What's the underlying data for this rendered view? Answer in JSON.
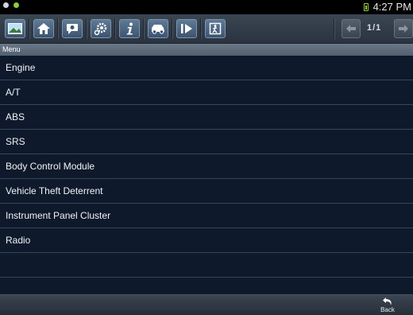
{
  "status_bar": {
    "time": "4:27 PM",
    "icons": [
      "gear-notification-icon",
      "leaf-notification-icon",
      "battery-icon"
    ]
  },
  "toolbar": {
    "buttons": [
      "screenshot-icon",
      "home-icon",
      "help-icon",
      "settings-icon",
      "info-icon",
      "vehicle-icon",
      "play-icon",
      "exit-icon"
    ],
    "page_indicator": "1/1",
    "nav": [
      "prev-page-icon",
      "next-page-icon"
    ]
  },
  "menu": {
    "header": "Menu",
    "items": [
      "Engine",
      "A/T",
      "ABS",
      "SRS",
      "Body Control Module",
      "Vehicle Theft Deterrent",
      "Instrument Panel Cluster",
      "Radio"
    ]
  },
  "bottom_bar": {
    "back_label": "Back"
  },
  "colors": {
    "list_background": "#0e1a2b",
    "toolbar_button": "#4d6683",
    "header": "#5d6b7a"
  }
}
